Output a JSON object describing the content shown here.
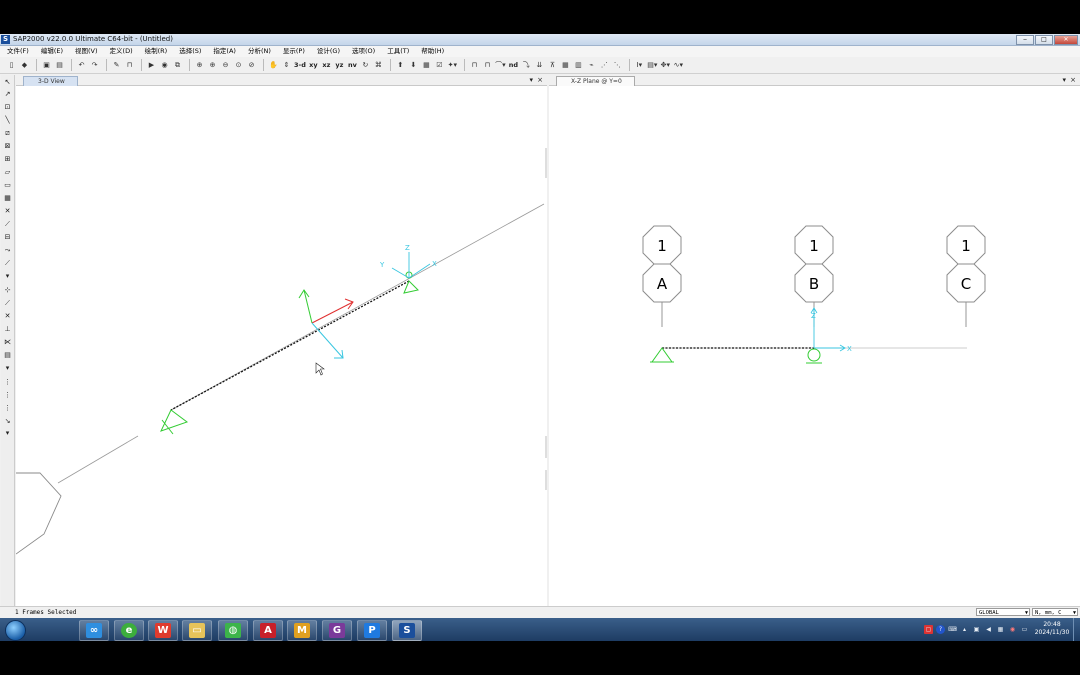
{
  "window": {
    "title": "SAP2000 v22.0.0 Ultimate C64-bit - (Untitled)",
    "logo_letter": "S",
    "controls": [
      "minimize",
      "maximize",
      "close"
    ]
  },
  "menu": [
    "文件(F)",
    "编辑(E)",
    "视图(V)",
    "定义(D)",
    "绘制(R)",
    "选择(S)",
    "指定(A)",
    "分析(N)",
    "显示(P)",
    "设计(G)",
    "选项(O)",
    "工具(T)",
    "帮助(H)"
  ],
  "toolbar": {
    "view_buttons": [
      "3-d",
      "xy",
      "xz",
      "yz",
      "nv"
    ],
    "nd_label": "nd"
  },
  "left_pane": {
    "tab_label": "3-D View",
    "pin": "▾",
    "close": "×"
  },
  "right_pane": {
    "tab_label": "X-Z Plane @ Y=0",
    "pin": "▾",
    "close": "×",
    "grid_bubbles": [
      {
        "top": "1",
        "bottom": "A"
      },
      {
        "top": "1",
        "bottom": "B"
      },
      {
        "top": "1",
        "bottom": "C"
      }
    ],
    "axis_labels": {
      "z": "Z",
      "x": "X"
    }
  },
  "view3d_axis_labels": {
    "z": "Z",
    "y": "Y",
    "x": "X"
  },
  "status": {
    "text": "1 Frames Selected",
    "coord_system": "GLOBAL",
    "units": "N, mm, C"
  },
  "taskbar": {
    "apps": [
      "baidu-netdisk",
      "browser-e",
      "wps",
      "file-manager",
      "wechat",
      "autocad",
      "mathcad",
      "glodon",
      "p-app",
      "sap2000"
    ],
    "time": "20:48",
    "date": "2024/11/30"
  },
  "colors": {
    "support": "#33cc33",
    "local_axis_cyan": "#39c6e0",
    "local_axis_red": "#e03030",
    "grid_bubble": "#8c8c8c",
    "frame": "#000000"
  }
}
